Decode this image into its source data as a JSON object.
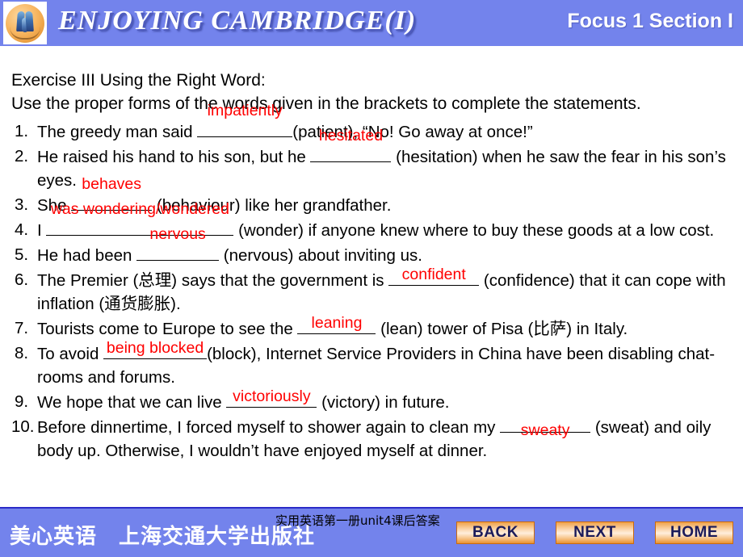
{
  "header": {
    "logo_alt": "enjoying-english-logo",
    "title": "ENJOYING  CAMBRIDGE(I)",
    "section": "Focus 1  Section I"
  },
  "content": {
    "exercise_title": "Exercise III  Using the Right Word:",
    "instruction": "Use the proper forms of the words given in the brackets to complete the statements.",
    "items": [
      {
        "num": "1.",
        "pre": "The greedy man said ",
        "answer": "impatiently",
        "answer_pos": "above",
        "blank_width": 118,
        "post": "(patient), “No! Go away at once!”"
      },
      {
        "num": "2.",
        "pre": "He raised his hand to his son, but he ",
        "answer": "hesitated",
        "answer_pos": "above",
        "blank_width": 100,
        "post": " (hesitation) when he saw the fear in his son’s eyes."
      },
      {
        "num": "3.",
        "pre": "She ",
        "answer": "behaves",
        "answer_pos": "above",
        "blank_width": 100,
        "post": " (behaviour) like her grandfather."
      },
      {
        "num": "4.",
        "pre": "I ",
        "answer": "was wondering/wondered",
        "answer_pos": "above",
        "blank_width": 232,
        "post": " (wonder) if anyone knew where to buy these goods at a low cost."
      },
      {
        "num": "5.",
        "pre": "He had been ",
        "answer": "nervous",
        "answer_pos": "above",
        "blank_width": 102,
        "post": " (nervous) about inviting us."
      },
      {
        "num": "6.",
        "pre": "The Premier (总理) says that the government is ",
        "answer": "confident",
        "answer_pos": "on",
        "blank_width": 112,
        "post": " (confidence) that it can cope with inflation (通货膨胀)."
      },
      {
        "num": "7.",
        "pre": "Tourists come to Europe to see the ",
        "answer": "leaning",
        "answer_pos": "on",
        "blank_width": 97,
        "post": " (lean) tower of Pisa (比萨) in Italy."
      },
      {
        "num": "8.",
        "pre": "To avoid ",
        "answer": "being blocked",
        "answer_pos": "on",
        "blank_width": 128,
        "post": "(block), Internet Service Providers in China have been disabling chat-rooms and forums."
      },
      {
        "num": "9.",
        "pre": "We hope that we can live ",
        "answer": "victoriously",
        "answer_pos": "on",
        "blank_width": 112,
        "post": " (victory) in future."
      },
      {
        "num": "10.",
        "pre": "Before dinnertime, I forced myself to shower again to clean my ",
        "answer": "sweaty",
        "answer_pos": "below",
        "blank_width": 112,
        "post": " (sweat) and oily body up. Otherwise, I wouldn’t have enjoyed myself at dinner."
      }
    ]
  },
  "footer": {
    "note": "实用英语第一册unit4课后答案",
    "brand": "美心英语　上海交通大学出版社",
    "buttons": [
      {
        "label": "BACK",
        "name": "back-button"
      },
      {
        "label": "NEXT",
        "name": "next-button"
      },
      {
        "label": "HOME",
        "name": "home-button"
      }
    ]
  },
  "colors": {
    "header_blue": "#7383ec",
    "answer_red": "#ff0000",
    "button_orange": "#f0a24a",
    "button_text": "#1b1b5a",
    "text_black": "#000000"
  }
}
